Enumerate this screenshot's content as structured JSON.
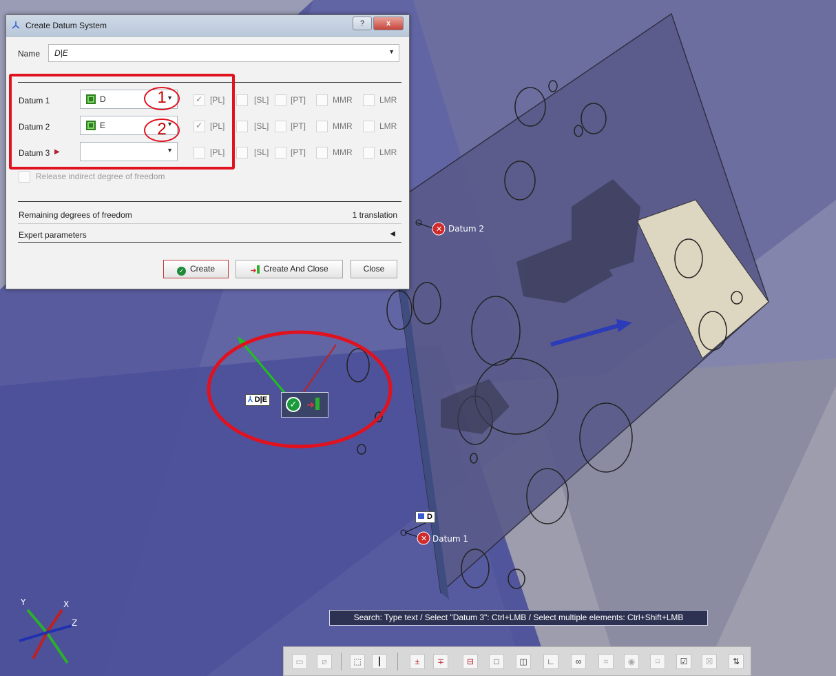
{
  "dialog": {
    "title": "Create Datum System",
    "help_button": "?",
    "close_button": "x",
    "name_label": "Name",
    "name_value": "D|E",
    "datums": [
      {
        "label": "Datum 1",
        "value": "D",
        "pl_checked": true
      },
      {
        "label": "Datum 2",
        "value": "E",
        "pl_checked": true
      },
      {
        "label": "Datum 3",
        "value": "",
        "pl_checked": false
      }
    ],
    "options": [
      "[PL]",
      "[SL]",
      "[PT]",
      "MMR",
      "LMR"
    ],
    "release_label": "Release indirect degree of freedom",
    "remaining_label": "Remaining degrees of freedom",
    "remaining_value": "1 translation",
    "expert_label": "Expert parameters",
    "create_button": "Create",
    "create_close_button": "Create And Close",
    "close_button_label": "Close"
  },
  "annotations": {
    "num1": "1",
    "num2": "2"
  },
  "viewport": {
    "datum2_label": "Datum 2",
    "datum1_label": "Datum 1",
    "d_tag": "D",
    "de_tag": "D|E",
    "axis_y": "Y",
    "axis_x": "X",
    "axis_z": "Z"
  },
  "tooltip": "Search: Type text / Select \"Datum 3\": Ctrl+LMB / Select multiple elements: Ctrl+Shift+LMB",
  "toolbar": {
    "icons": [
      "frame-icon",
      "diagonal-icon",
      "select-icon",
      "split-icon",
      "datum-plus-icon",
      "datum-cross-icon",
      "toggle-icon",
      "box-icon",
      "frame-box-icon",
      "angle-icon",
      "link-icon",
      "grid-icon",
      "sphere-icon",
      "bracket-icon",
      "check-box-icon",
      "x-box-icon",
      "swap-icon"
    ]
  },
  "colors": {
    "accent_red": "#e0121f",
    "plane_blue": "#4b4f99",
    "tooltip_bg": "#2d3252"
  }
}
